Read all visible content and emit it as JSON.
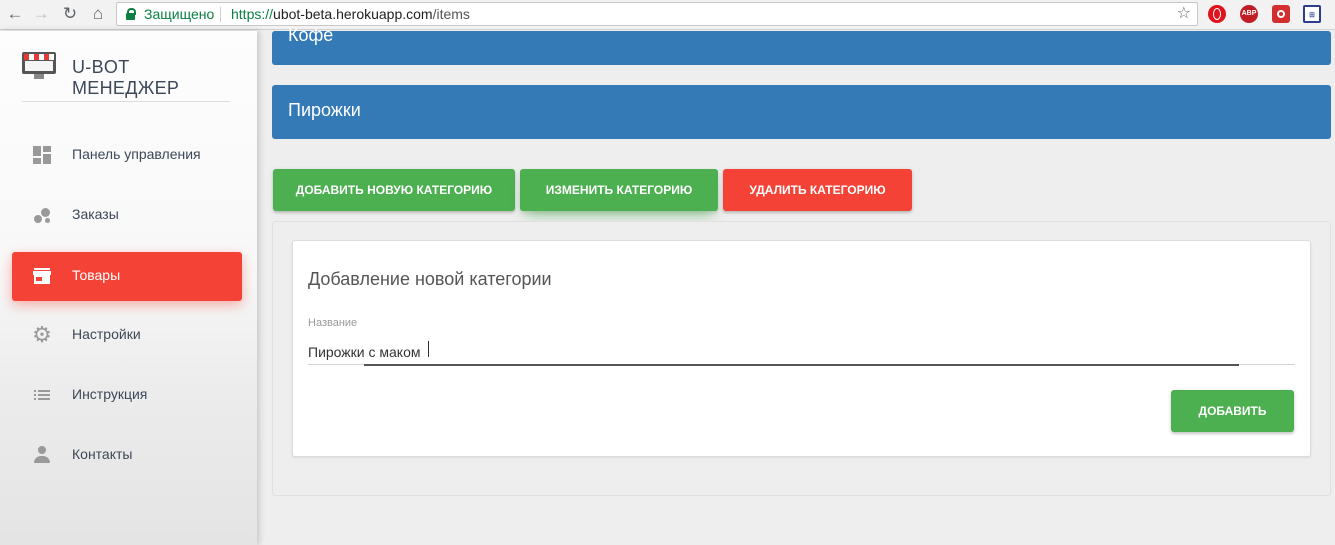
{
  "browser": {
    "secure_label": "Защищено",
    "url_scheme": "https://",
    "url_host": "ubot-beta.herokuapp.com",
    "url_path": "/items",
    "extensions": [
      "opera-icon",
      "adblock-plus-icon",
      "youtube-like-icon",
      "ext-blue-icon"
    ],
    "abp_text": "ABP"
  },
  "sidebar": {
    "brand": "U-BOT МЕНЕДЖЕР",
    "items": [
      {
        "label": "Панель управления",
        "icon": "dashboard-icon",
        "active": false
      },
      {
        "label": "Заказы",
        "icon": "bubbles-icon",
        "active": false
      },
      {
        "label": "Товары",
        "icon": "store-icon",
        "active": true
      },
      {
        "label": "Настройки",
        "icon": "gear-icon",
        "active": false
      },
      {
        "label": "Инструкция",
        "icon": "list-icon",
        "active": false
      },
      {
        "label": "Контакты",
        "icon": "person-icon",
        "active": false
      }
    ]
  },
  "categories": [
    "Кофе",
    "Пирожки"
  ],
  "actions": {
    "add_category": "ДОБАВИТЬ НОВУЮ КАТЕГОРИЮ",
    "edit_category": "ИЗМЕНИТЬ КАТЕГОРИЮ",
    "delete_category": "УДАЛИТЬ КАТЕГОРИЮ"
  },
  "form": {
    "title": "Добавление новой категории",
    "name_label": "Название",
    "name_value": "Пирожки с маком",
    "submit_label": "ДОБАВИТЬ"
  },
  "colors": {
    "primary_blue": "#337ab7",
    "success_green": "#4caf50",
    "danger_red": "#f44336"
  }
}
